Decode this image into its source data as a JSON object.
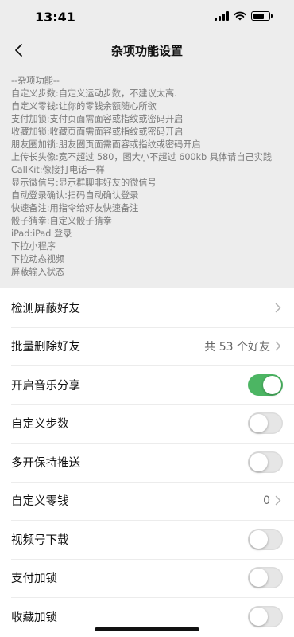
{
  "status_bar": {
    "time": "13:41"
  },
  "nav": {
    "title": "杂项功能设置"
  },
  "description": {
    "lines": [
      "--杂项功能--",
      "自定义步数:自定义运动步数，不建议太高.",
      "自定义零钱:让你的零钱余额随心所欲",
      "支付加锁:支付页面需面容或指纹或密码开启",
      "收藏加锁:收藏页面需面容或指纹或密码开启",
      "朋友圈加锁:朋友圈页面需面容或指纹或密码开启",
      "上传长头像:宽不超过 580，图大小不超过 600kb 具体请自己实践",
      "CallKit:像接打电话一样",
      "显示微信号:显示群聊非好友的微信号",
      "自动登录确认:扫码自动确认登录",
      "快速备注:用指令给好友快速备注",
      "骰子猜拳:自定义骰子猜拳",
      "iPad:iPad 登录",
      "下拉小程序",
      "下拉动态视频",
      "屏蔽输入状态"
    ]
  },
  "settings": {
    "detect_blocked": {
      "label": "检测屏蔽好友"
    },
    "batch_delete": {
      "label": "批量删除好友",
      "value": "共 53 个好友"
    },
    "music_share": {
      "label": "开启音乐分享",
      "enabled": true
    },
    "custom_steps": {
      "label": "自定义步数",
      "enabled": false
    },
    "multi_push": {
      "label": "多开保持推送",
      "enabled": false
    },
    "custom_change": {
      "label": "自定义零钱",
      "value": "0"
    },
    "channels_download": {
      "label": "视频号下载",
      "enabled": false
    },
    "pay_lock": {
      "label": "支付加锁",
      "enabled": false
    },
    "fav_lock": {
      "label": "收藏加锁",
      "enabled": false
    }
  },
  "colors": {
    "accent": "#4cb563",
    "background": "#ededed"
  }
}
